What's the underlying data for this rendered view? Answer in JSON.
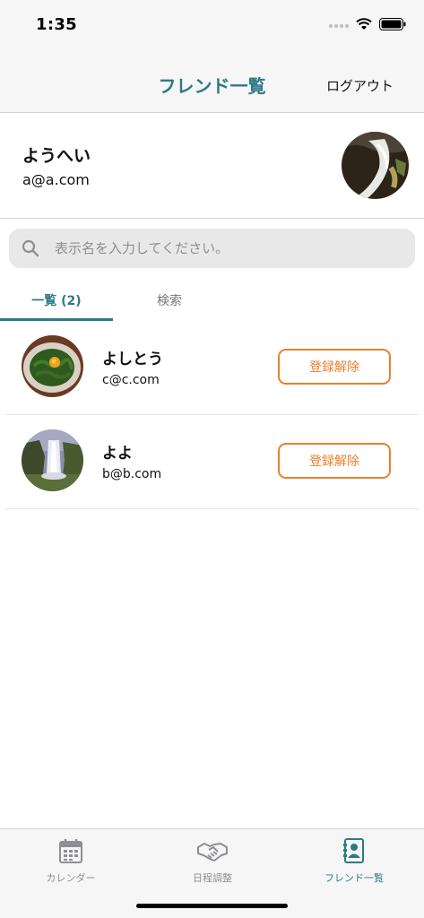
{
  "status_bar": {
    "time": "1:35"
  },
  "nav": {
    "title": "フレンド一覧",
    "logout_label": "ログアウト"
  },
  "profile": {
    "name": "ようへい",
    "email": "a@a.com"
  },
  "search": {
    "placeholder": "表示名を入力してください。"
  },
  "tabs": [
    {
      "label": "一覧 (2)",
      "active": true
    },
    {
      "label": "検索",
      "active": false
    }
  ],
  "friends": [
    {
      "name": "よしとう",
      "email": "c@c.com",
      "button_label": "登録解除"
    },
    {
      "name": "よよ",
      "email": "b@b.com",
      "button_label": "登録解除"
    }
  ],
  "tab_bar": [
    {
      "label": "カレンダー",
      "icon": "calendar-icon",
      "active": false
    },
    {
      "label": "日程調整",
      "icon": "handshake-icon",
      "active": false
    },
    {
      "label": "フレンド一覧",
      "icon": "contacts-icon",
      "active": true
    }
  ],
  "colors": {
    "accent": "#2d7a86",
    "button": "#e8812b"
  }
}
